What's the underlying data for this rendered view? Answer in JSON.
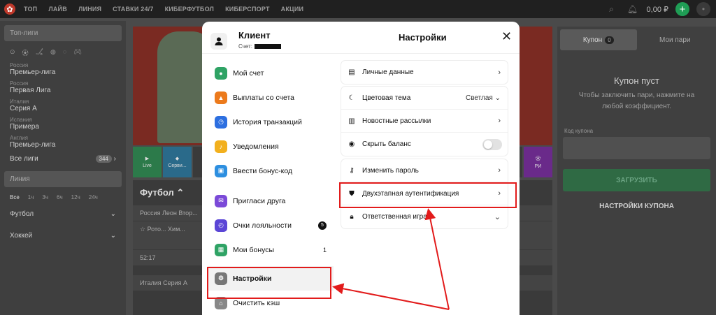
{
  "topbar": {
    "nav": [
      "ТОП",
      "ЛАЙВ",
      "ЛИНИЯ",
      "СТАВКИ 24/7",
      "КИБЕРФУТБОЛ",
      "КИБЕРСПОРТ",
      "АКЦИИ"
    ],
    "balance": "0,00 ₽"
  },
  "left": {
    "top_leagues": "Топ-лиги",
    "leagues": [
      {
        "country": "Россия",
        "name": "Премьер-лига"
      },
      {
        "country": "Россия",
        "name": "Первая Лига"
      },
      {
        "country": "Италия",
        "name": "Серия А"
      },
      {
        "country": "Испания",
        "name": "Примера"
      },
      {
        "country": "Англия",
        "name": "Премьер-лига"
      }
    ],
    "all_leagues": "Все лиги",
    "all_count": "344",
    "line": "Линия",
    "times": [
      "Все",
      "1ч",
      "3ч",
      "6ч",
      "12ч",
      "24ч"
    ],
    "sports": [
      "Футбол",
      "Хоккей"
    ]
  },
  "center": {
    "tiles": [
      "Live",
      "Серви...",
      "",
      "",
      "",
      "",
      "",
      "",
      "",
      "",
      "",
      "",
      "",
      "РИ"
    ],
    "title": "Футбол",
    "rows": [
      "Россия Леон Втор...",
      "Рото...",
      "Хим...",
      "52:17",
      "Италия Серия А"
    ]
  },
  "right": {
    "tab_coupon": "Купон",
    "tab_coupon_count": "0",
    "tab_my": "Мои пари",
    "empty_title": "Купон пуст",
    "empty_desc": "Чтобы заключить пари, нажмите на любой коэффициент.",
    "code_label": "Код купона",
    "load_btn": "ЗАГРУЗИТЬ",
    "settings": "НАСТРОЙКИ КУПОНА"
  },
  "modal": {
    "client": "Клиент",
    "account_label": "Счет:",
    "title": "Настройки",
    "menu": [
      {
        "label": "Мой счет",
        "color": "#2fa365",
        "icon": "user-icon"
      },
      {
        "label": "Выплаты со счета",
        "color": "#ec7a1c",
        "icon": "upload-icon"
      },
      {
        "label": "История транзакций",
        "color": "#2d6fe0",
        "icon": "clock-icon"
      },
      {
        "label": "Уведомления",
        "color": "#f2b01e",
        "icon": "bell-icon"
      },
      {
        "label": "Ввести бонус-код",
        "color": "#2d8fe0",
        "icon": "ticket-icon"
      },
      {
        "label": "Пригласи друга",
        "color": "#7b4ad8",
        "icon": "gift-icon"
      },
      {
        "label": "Очки лояльности",
        "color": "#5b46d6",
        "icon": "clock-icon",
        "badge": "5"
      },
      {
        "label": "Мои бонусы",
        "color": "#2fa365",
        "icon": "gift-icon",
        "count": "1"
      },
      {
        "label": "Настройки",
        "color": "#777",
        "icon": "gear-icon"
      },
      {
        "label": "Очистить кэш",
        "color": "#888",
        "icon": "broom-icon"
      }
    ],
    "settings": {
      "personal": "Личные данные",
      "theme": "Цветовая тема",
      "theme_value": "Светлая",
      "newsletter": "Новостные рассылки",
      "hide_balance": "Скрыть баланс",
      "change_password": "Изменить пароль",
      "two_factor": "Двухэтапная аутентификация",
      "responsible": "Ответственная игра"
    }
  },
  "colors": {
    "highlight": "#e21b1b",
    "green": "#1f9d55"
  }
}
